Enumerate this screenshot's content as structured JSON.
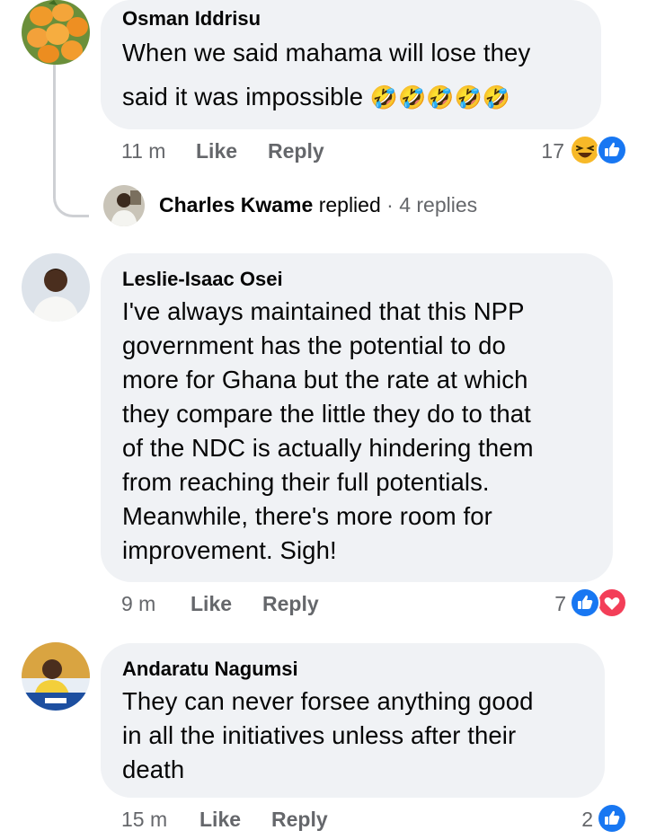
{
  "comments": [
    {
      "author": "Osman Iddrisu",
      "lines": [
        "When we said mahama will lose they",
        "said it was impossible"
      ],
      "emoji": "🤣🤣🤣🤣🤣",
      "time": "11 m",
      "like_label": "Like",
      "reply_label": "Reply",
      "reaction_count": "17",
      "reactions": [
        "haha-reaction",
        "like-reaction"
      ]
    },
    {
      "author": "Leslie-Isaac Osei",
      "lines": [
        "I've always maintained that this NPP",
        "government has the potential to do",
        "more for Ghana but the rate at which",
        "they compare the little they do to that",
        "of the NDC is actually hindering them",
        "from reaching their full potentials.",
        "Meanwhile, there's more room for",
        "improvement. Sigh!"
      ],
      "time": "9 m",
      "like_label": "Like",
      "reply_label": "Reply",
      "reaction_count": "7",
      "reactions": [
        "like-reaction",
        "love-reaction"
      ]
    },
    {
      "author": "Andaratu Nagumsi",
      "lines": [
        "They can never forsee anything good",
        "in all the initiatives unless after their",
        "death"
      ],
      "time": "15 m",
      "like_label": "Like",
      "reply_label": "Reply",
      "reaction_count": "2",
      "reactions": [
        "like-reaction"
      ]
    }
  ],
  "reply_thread": {
    "author": "Charles Kwame",
    "action": "replied",
    "separator": "·",
    "count_text": "4 replies"
  },
  "colors": {
    "bubble": "#f0f2f5",
    "meta": "#65676b",
    "like_blue": "#1877f2",
    "love_red": "#f33e58",
    "haha_yellow": "#f7b928"
  }
}
